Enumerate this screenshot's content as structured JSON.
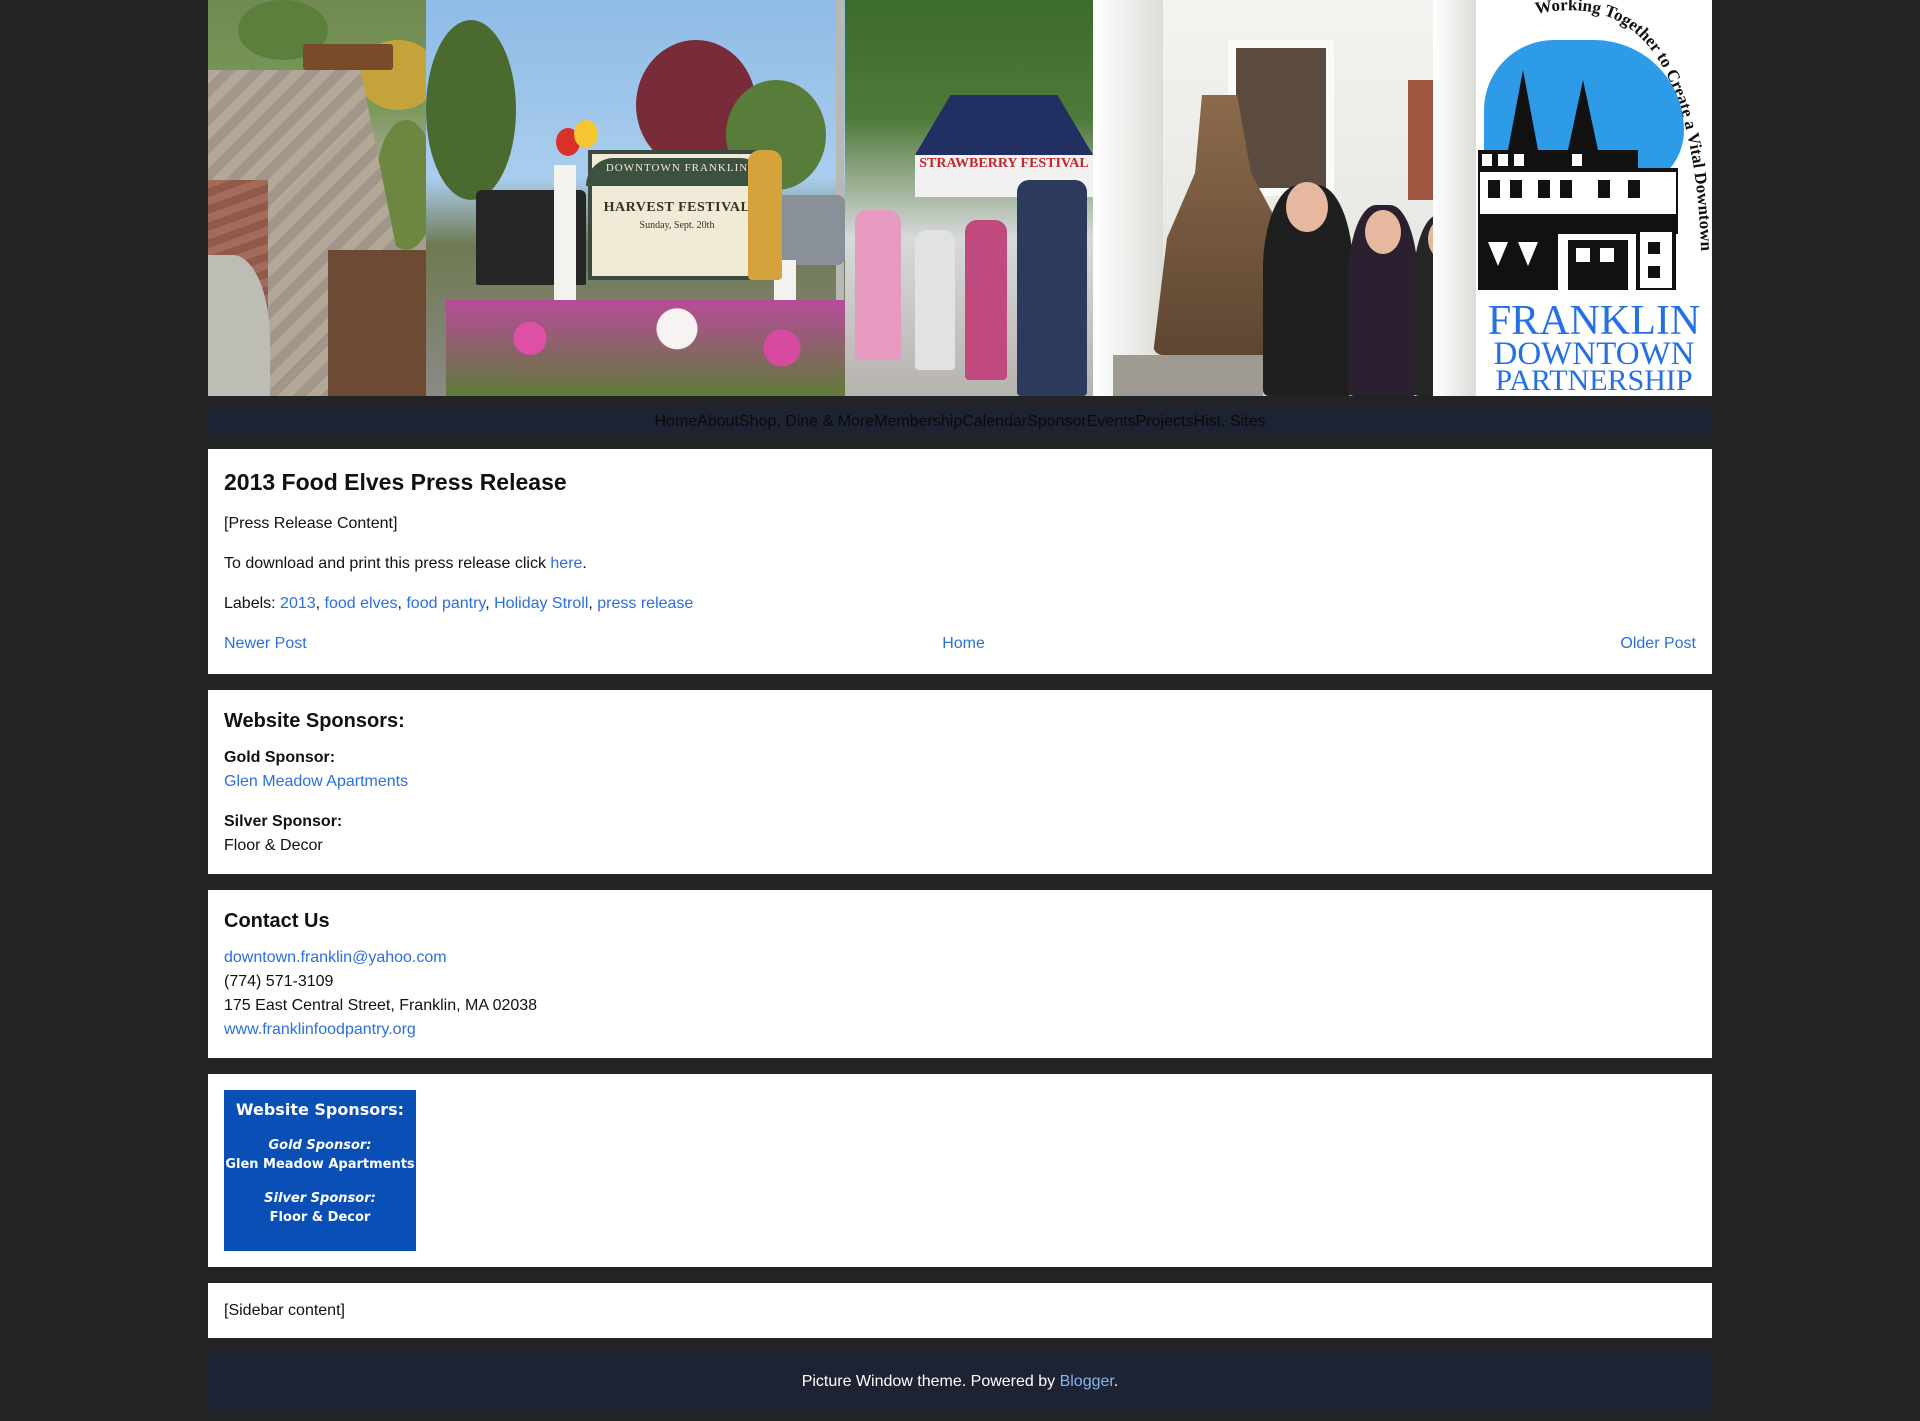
{
  "logo": {
    "motto": "Working Together to Create a Vital Downtown",
    "line1": "FRANKLIN",
    "line2": "DOWNTOWN",
    "line3": "PARTNERSHIP"
  },
  "banner_photo_text": {
    "sign_line1": "DOWNTOWN FRANKLIN",
    "sign_line2": "HARVEST FESTIVAL",
    "sign_line3": "Sunday, Sept. 20th",
    "tent_banner": "STRAWBERRY FESTIVAL"
  },
  "nav": {
    "items": [
      "Home",
      "About",
      "Shop, Dine & More",
      "Membership",
      "Calendar",
      "Sponsor",
      "Events",
      "Projects",
      "Hist. Sites"
    ]
  },
  "post": {
    "title": "2013 Food Elves Press Release",
    "content": "[Press Release Content]",
    "download_prefix": "To download and print this press release click ",
    "download_link": "here",
    "download_suffix": ".",
    "labels_prefix": "Labels: ",
    "labels": [
      "2013",
      "food elves",
      "food pantry",
      "Holiday Stroll",
      "press release"
    ],
    "newer": "Newer Post",
    "home": "Home",
    "older": "Older Post"
  },
  "sponsors": {
    "title": "Website Sponsors:",
    "gold_label": "Gold Sponsor:",
    "gold_value": "Glen Meadow Apartments",
    "silver_label": "Silver Sponsor:",
    "silver_value": "Floor & Decor"
  },
  "contact": {
    "title": "Contact Us",
    "email": "downtown.franklin@yahoo.com",
    "phone": "(774) 571-3109",
    "address": "175 East Central Street, Franklin, MA 02038",
    "website": "www.franklinfoodpantry.org"
  },
  "sponsor_image": {
    "title": "Website Sponsors:",
    "gold_label": "Gold Sponsor:",
    "gold_value": "Glen Meadow Apartments",
    "silver_label": "Silver Sponsor:",
    "silver_value": "Floor & Decor",
    "bg_color": "#0a4fb6"
  },
  "sidebar": {
    "content": "[Sidebar content]"
  },
  "footer": {
    "prefix": "Picture Window theme. Powered by ",
    "link": "Blogger",
    "suffix": "."
  },
  "colors": {
    "page_bg": "#222324",
    "nav_bg": "#1d2332",
    "link": "#2a6fdd",
    "footer_link": "#84b6f2",
    "logo_blue": "#2370e6"
  }
}
